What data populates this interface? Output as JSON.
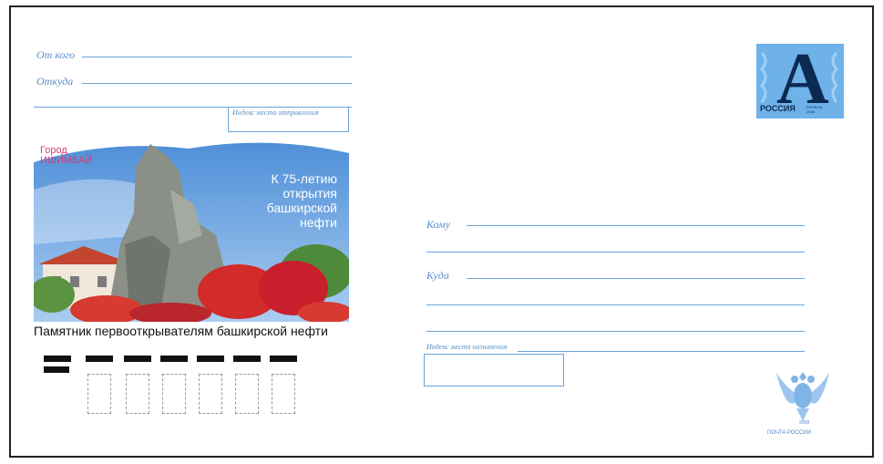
{
  "sender": {
    "from_label": "От кого",
    "where_from_label": "Откуда",
    "postcode_label": "Индекс места отправления"
  },
  "illustration": {
    "town_label": "Город",
    "town_name": "ИШИМБАЙ",
    "anniversary": [
      "К 75-летию",
      "открытия",
      "башкирской",
      "нефти"
    ],
    "caption": "Памятник первооткрывателям башкирской нефти"
  },
  "stamp": {
    "letter": "А",
    "country": "РОССИЯ",
    "small_text": [
      "ROSSIJA",
      "2008"
    ]
  },
  "recipient": {
    "to_label": "Кому",
    "where_label": "Куда",
    "postcode_label": "Индекс места назначения"
  },
  "footer": {
    "post_name": "ПОЧТА РОССИИ",
    "year": "2008"
  },
  "colors": {
    "line_blue": "#6aa3d8",
    "stamp_blue": "#6fb2ea",
    "town_pink": "#d23d7c"
  }
}
